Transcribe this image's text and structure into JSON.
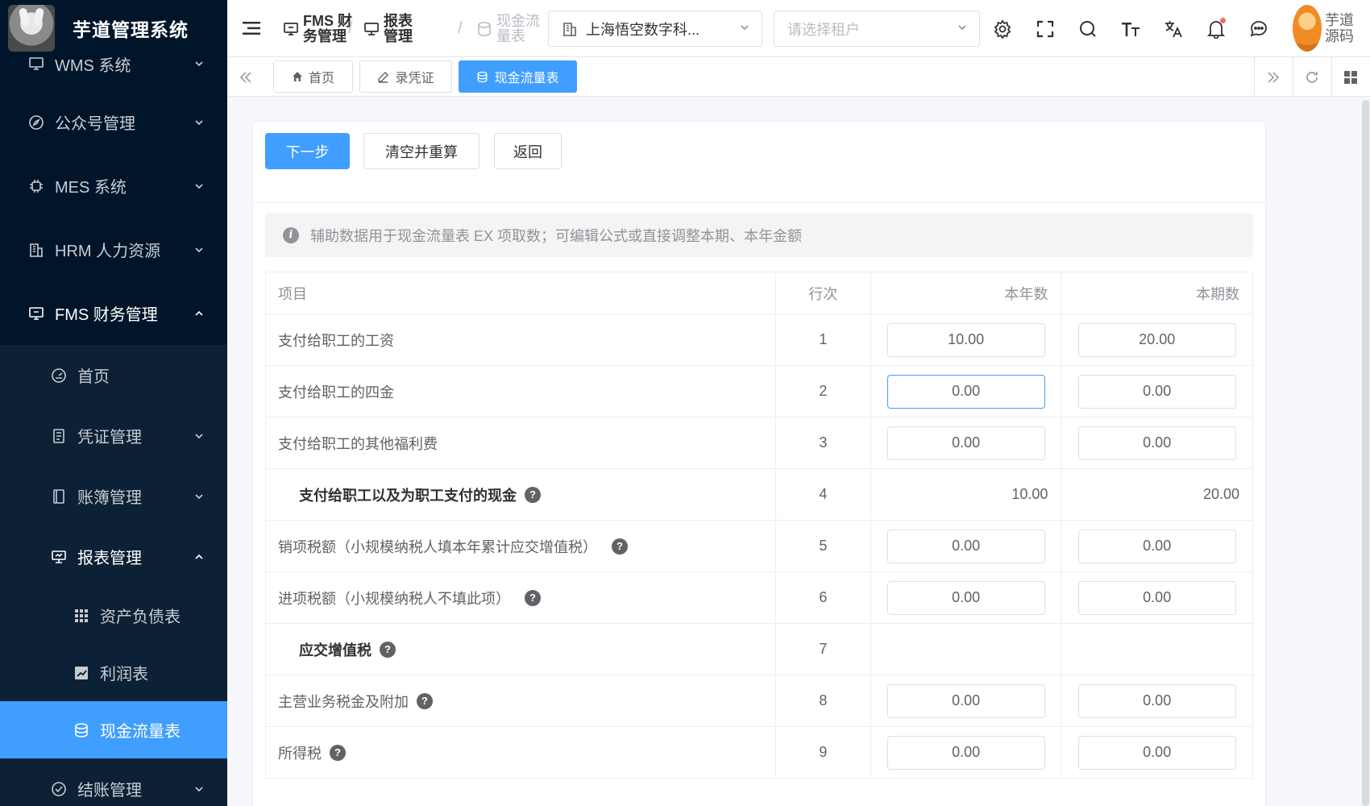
{
  "app": {
    "title": "芋道管理系统"
  },
  "sidebar": {
    "items": [
      {
        "label": "WMS 系统"
      },
      {
        "label": "公众号管理"
      },
      {
        "label": "MES 系统"
      },
      {
        "label": "HRM 人力资源"
      },
      {
        "label": "FMS 财务管理"
      }
    ],
    "fms_children": [
      {
        "label": "首页"
      },
      {
        "label": "凭证管理"
      },
      {
        "label": "账簿管理"
      },
      {
        "label": "报表管理"
      }
    ],
    "report_children": [
      {
        "label": "资产负债表"
      },
      {
        "label": "利润表"
      },
      {
        "label": "现金流量表"
      }
    ],
    "after": {
      "label": "结账管理"
    }
  },
  "header": {
    "breadcrumb": [
      "FMS 财务管理",
      "报表管理",
      "现金流量表"
    ],
    "company_select": "上海悟空数字科...",
    "tenant_placeholder": "请选择租户",
    "user_name": "芋道源码"
  },
  "tags": [
    "首页",
    "录凭证",
    "现金流量表"
  ],
  "toolbar": {
    "next": "下一步",
    "clear": "清空并重算",
    "back": "返回"
  },
  "alert": "辅助数据用于现金流量表 EX 项取数；可编辑公式或直接调整本期、本年金额",
  "table": {
    "headers": {
      "item": "项目",
      "line": "行次",
      "year": "本年数",
      "period": "本期数"
    },
    "rows": [
      {
        "name": "支付给职工的工资",
        "line": "1",
        "year": "10.00",
        "period": "20.00"
      },
      {
        "name": "支付给职工的四金",
        "line": "2",
        "year": "0.00",
        "period": "0.00"
      },
      {
        "name": "支付给职工的其他福利费",
        "line": "3",
        "year": "0.00",
        "period": "0.00"
      },
      {
        "name": "支付给职工以及为职工支付的现金",
        "line": "4",
        "year": "10.00",
        "period": "20.00"
      },
      {
        "name": "销项税额（小规模纳税人填本年累计应交增值税）",
        "line": "5",
        "year": "0.00",
        "period": "0.00"
      },
      {
        "name": "进项税额（小规模纳税人不填此项）",
        "line": "6",
        "year": "0.00",
        "period": "0.00"
      },
      {
        "name": "应交增值税",
        "line": "7",
        "year": "",
        "period": ""
      },
      {
        "name": "主营业务税金及附加",
        "line": "8",
        "year": "0.00",
        "period": "0.00"
      },
      {
        "name": "所得税",
        "line": "9",
        "year": "0.00",
        "period": "0.00"
      }
    ]
  },
  "colors": {
    "primary": "#409eff",
    "sidebar_bg": "#001529"
  }
}
